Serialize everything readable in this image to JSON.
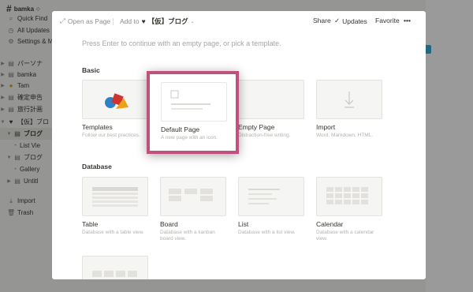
{
  "sidebar": {
    "workspace": "bamka",
    "items": [
      {
        "label": "Quick Find",
        "icon": "search-icon"
      },
      {
        "label": "All Updates",
        "icon": "clock-icon"
      },
      {
        "label": "Settings & M",
        "icon": "gear-icon"
      },
      {
        "label": "パーソナ",
        "icon": "page-icon"
      },
      {
        "label": "bamka",
        "icon": "page-icon"
      },
      {
        "label": "Tam",
        "icon": "emoji-icon"
      },
      {
        "label": "確定申告",
        "icon": "page-icon"
      },
      {
        "label": "旅行計画",
        "icon": "page-icon"
      },
      {
        "label": "【仮】ブロ",
        "icon": "heart-icon"
      },
      {
        "label": "ブログ",
        "icon": "page-icon"
      },
      {
        "label": "List Vie",
        "icon": "list-icon"
      },
      {
        "label": "ブログ",
        "icon": "page-icon"
      },
      {
        "label": "Gallery",
        "icon": "grid-icon"
      },
      {
        "label": "Untitl",
        "icon": "page-icon"
      },
      {
        "label": "Import",
        "icon": "import-icon"
      },
      {
        "label": "Trash",
        "icon": "trash-icon"
      }
    ]
  },
  "topbar": {
    "open_as_page": "Open as Page",
    "add_to": "Add to",
    "page_name": "【仮】ブログ",
    "share": "Share",
    "updates": "Updates",
    "favorite": "Favorite",
    "more": "•••"
  },
  "prompt": "Press Enter to continue with an empty page, or pick a template.",
  "sections": {
    "basic": "Basic",
    "database": "Database"
  },
  "basic_cards": [
    {
      "name": "Templates",
      "desc": "Follow our best practices."
    },
    {
      "name": "Default Page",
      "desc": "A new page with an icon."
    },
    {
      "name": "Empty Page",
      "desc": "Distraction-free writing."
    },
    {
      "name": "Import",
      "desc": "Word, Markdown, HTML."
    }
  ],
  "database_cards": [
    {
      "name": "Table",
      "desc": "Database with a table view."
    },
    {
      "name": "Board",
      "desc": "Database with a kanban board view."
    },
    {
      "name": "List",
      "desc": "Database with a list view."
    },
    {
      "name": "Calendar",
      "desc": "Database with a calendar view."
    }
  ],
  "colors": {
    "highlight": "#c2507c",
    "overlay": "rgba(15,15,15,0.42)",
    "accent_blue": "#2eaadc"
  }
}
